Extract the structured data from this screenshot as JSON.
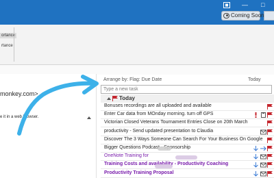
{
  "titlebar": {
    "coming_soon_label": "Coming Soon"
  },
  "ribbon": {
    "item1": "ortance",
    "item2": "rtance"
  },
  "reading_pane": {
    "email_fragment": "monkey.com>",
    "browser_fragment": "e it in a web browser."
  },
  "tasks": {
    "arrange_label": "Arrange by: Flag: Due Date",
    "today_header": "Today",
    "new_task_placeholder": "Type a new task",
    "group_label": "Today",
    "rows": [
      {
        "text": "Bonuses recordings are all uploaded and available",
        "style": "normal",
        "icons": [
          "flag"
        ]
      },
      {
        "text": "Enter Car data from MOnday morning. turn off GPS",
        "style": "normal",
        "icons": [
          "exclamation",
          "clipboard",
          "flag"
        ]
      },
      {
        "text": "Victorian Closed Veterans Tournament Entries Close on 20th March",
        "style": "normal",
        "icons": [
          "flag"
        ]
      },
      {
        "text": "productivity - Send updated presentation to Claudia",
        "style": "normal",
        "icons": [
          "envelope",
          "flag"
        ]
      },
      {
        "text": "Discover The 3 Ways Someone Can Search For Your Business On Google",
        "style": "normal",
        "icons": [
          "flag"
        ]
      },
      {
        "text": "Bigger Questions Podcast - Sponsorship",
        "style": "normal",
        "icons": [
          "arrow-down",
          "arrow-right",
          "flag"
        ]
      },
      {
        "text": "OneNote Training for",
        "style": "purple",
        "icons": [
          "arrow-down",
          "envelope",
          "flag"
        ]
      },
      {
        "text": "Training Costs and availability - Productivity Coaching",
        "style": "purple-bold",
        "icons": [
          "arrow-down",
          "envelope",
          "flag"
        ]
      },
      {
        "text": "Productivity Training Proposal",
        "style": "purple-bold",
        "icons": [
          "arrow-down",
          "envelope",
          "flag"
        ]
      }
    ]
  },
  "colors": {
    "titlebar": "#1f72c1",
    "arrow": "#3db1e9",
    "flag": "#c4262e",
    "purple_text": "#7719aa"
  }
}
